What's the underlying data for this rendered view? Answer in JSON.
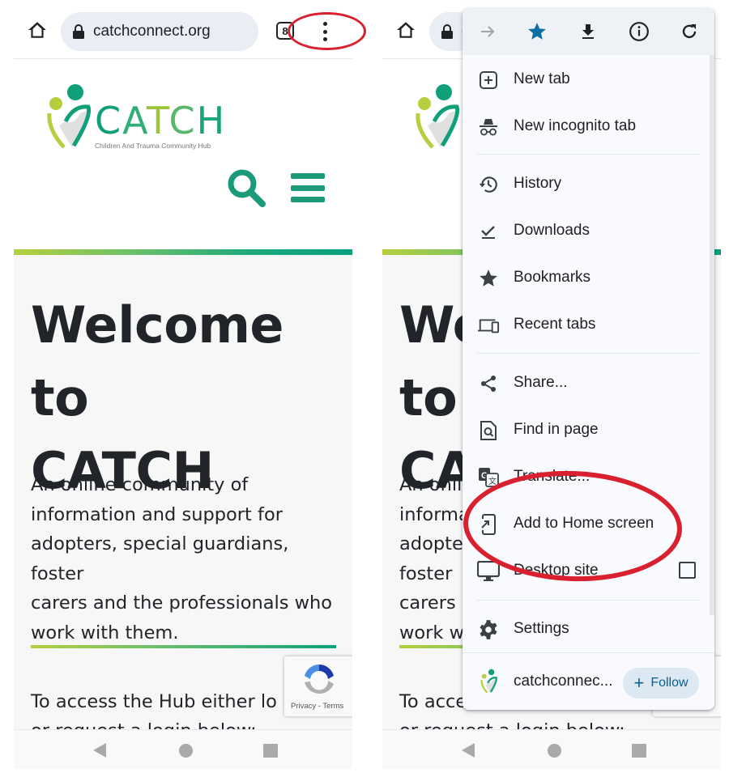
{
  "browser": {
    "url": "catchconnect.org",
    "tab_count": "8"
  },
  "site": {
    "logo_word": [
      "C",
      "A",
      "T",
      "C",
      "H"
    ],
    "logo_tagline": "Children And Trauma Community Hub",
    "hero_title_line1": "Welcome to",
    "hero_title_line2": "CATCH",
    "hero_body": [
      "An online community of",
      "information and support for",
      "adopters, special guardians, foster",
      "carers and the professionals who",
      "work with them."
    ],
    "access_line1": "To access the Hub either lo",
    "access_line2": "or request a login below:",
    "recaptcha_links": "Privacy - Terms"
  },
  "menu": {
    "top_icons": [
      "forward-icon",
      "bookmark-star-icon",
      "download-icon",
      "info-icon",
      "refresh-icon"
    ],
    "items": [
      {
        "label": "New tab",
        "icon": "new-tab-icon"
      },
      {
        "label": "New incognito tab",
        "icon": "incognito-icon"
      },
      {
        "label": "History",
        "icon": "history-icon"
      },
      {
        "label": "Downloads",
        "icon": "downloads-icon"
      },
      {
        "label": "Bookmarks",
        "icon": "bookmarks-icon"
      },
      {
        "label": "Recent tabs",
        "icon": "recent-tabs-icon"
      },
      {
        "label": "Share...",
        "icon": "share-icon"
      },
      {
        "label": "Find in page",
        "icon": "find-in-page-icon"
      },
      {
        "label": "Translate...",
        "icon": "translate-icon"
      },
      {
        "label": "Add to Home screen",
        "icon": "add-to-home-icon"
      },
      {
        "label": "Desktop site",
        "icon": "desktop-icon",
        "checked": false
      },
      {
        "label": "Settings",
        "icon": "settings-icon"
      }
    ],
    "footer": {
      "site_name": "catchconnec...",
      "follow_label": "Follow"
    }
  },
  "colors": {
    "brand_green": "#1a9a78",
    "brand_lime": "#b5cf3e",
    "annotation_red": "#d9202e",
    "star_blue": "#0b6fa4"
  }
}
